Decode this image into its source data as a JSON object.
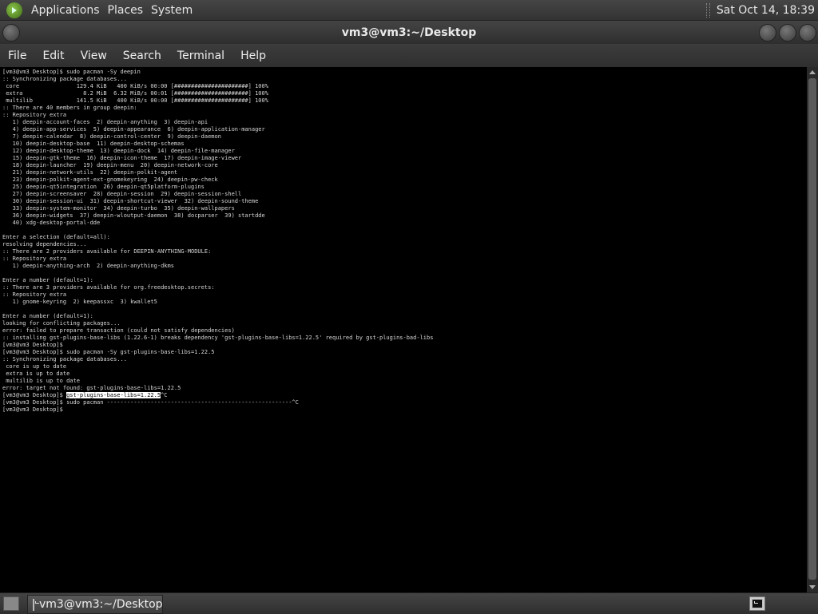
{
  "top_panel": {
    "menus": [
      "Applications",
      "Places",
      "System"
    ],
    "clock": "Sat Oct 14, 18:39"
  },
  "window": {
    "title": "vm3@vm3:~/Desktop",
    "menu": [
      "File",
      "Edit",
      "View",
      "Search",
      "Terminal",
      "Help"
    ]
  },
  "terminal": {
    "lines": [
      "[vm3@vm3 Desktop]$ sudo pacman -Sy deepin",
      ":: Synchronizing package databases...",
      " core                 129.4 KiB   400 KiB/s 00:00 [######################] 100%",
      " extra                  8.2 MiB  6.32 MiB/s 00:01 [######################] 100%",
      " multilib             141.5 KiB   400 KiB/s 00:00 [######################] 100%",
      ":: There are 40 members in group deepin:",
      ":: Repository extra",
      "   1) deepin-account-faces  2) deepin-anything  3) deepin-api",
      "   4) deepin-app-services  5) deepin-appearance  6) deepin-application-manager",
      "   7) deepin-calendar  8) deepin-control-center  9) deepin-daemon",
      "   10) deepin-desktop-base  11) deepin-desktop-schemas",
      "   12) deepin-desktop-theme  13) deepin-dock  14) deepin-file-manager",
      "   15) deepin-gtk-theme  16) deepin-icon-theme  17) deepin-image-viewer",
      "   18) deepin-launcher  19) deepin-menu  20) deepin-network-core",
      "   21) deepin-network-utils  22) deepin-polkit-agent",
      "   23) deepin-polkit-agent-ext-gnomekeyring  24) deepin-pw-check",
      "   25) deepin-qt5integration  26) deepin-qt5platform-plugins",
      "   27) deepin-screensaver  28) deepin-session  29) deepin-session-shell",
      "   30) deepin-session-ui  31) deepin-shortcut-viewer  32) deepin-sound-theme",
      "   33) deepin-system-monitor  34) deepin-turbo  35) deepin-wallpapers",
      "   36) deepin-widgets  37) deepin-wloutput-daemon  38) docparser  39) startdde",
      "   40) xdg-desktop-portal-dde",
      "",
      "Enter a selection (default=all):",
      "resolving dependencies...",
      ":: There are 2 providers available for DEEPIN-ANYTHING-MODULE:",
      ":: Repository extra",
      "   1) deepin-anything-arch  2) deepin-anything-dkms",
      "",
      "Enter a number (default=1):",
      ":: There are 3 providers available for org.freedesktop.secrets:",
      ":: Repository extra",
      "   1) gnome-keyring  2) keepassxc  3) kwallet5",
      "",
      "Enter a number (default=1):",
      "looking for conflicting packages...",
      "error: failed to prepare transaction (could not satisfy dependencies)",
      ":: installing gst-plugins-base-libs (1.22.6-1) breaks dependency 'gst-plugins-base-libs=1.22.5' required by gst-plugins-bad-libs",
      "[vm3@vm3 Desktop]$",
      "[vm3@vm3 Desktop]$ sudo pacman -Sy gst-plugins-base-libs=1.22.5",
      ":: Synchronizing package databases...",
      " core is up to date",
      " extra is up to date",
      " multilib is up to date",
      "error: target not found: gst-plugins-base-libs=1.22.5"
    ],
    "selected_prompt": "[vm3@vm3 Desktop]$ ",
    "selected_text": "gst-plugins-base-libs=1.22.5",
    "selected_suffix": "^C",
    "after_lines": [
      "[vm3@vm3 Desktop]$ sudo pacman -------------------------------------------------------^C",
      "[vm3@vm3 Desktop]$"
    ]
  },
  "bottom_panel": {
    "task_label": "vm3@vm3:~/Desktop"
  },
  "icons": {
    "panel_logo": "gnome-foot-icon",
    "task": "terminal-icon",
    "show_desktop": "show-desktop-icon"
  }
}
